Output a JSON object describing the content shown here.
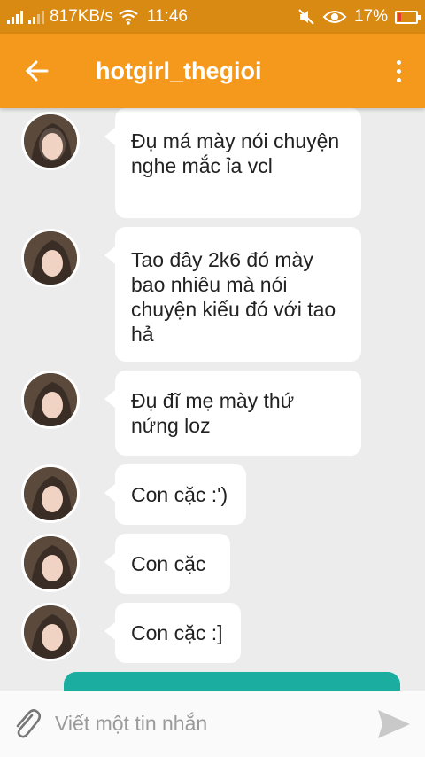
{
  "status_bar": {
    "speed": "817KB/s",
    "time": "11:46",
    "battery": "17%",
    "colors": {
      "background": "#d98a12",
      "battery_low": "#e53935"
    }
  },
  "header": {
    "title": "hotgirl_thegioi",
    "background": "#f4991b"
  },
  "messages": [
    {
      "sender": "incoming",
      "text": "Đụ má mày nói chuyện nghe mắc ỉa vcl"
    },
    {
      "sender": "incoming",
      "text": "Tao đây 2k6 đó mày bao nhiêu mà nói chuyện kiểu đó với tao hả"
    },
    {
      "sender": "incoming",
      "text": "Đụ đĩ mẹ mày thứ nứng loz"
    },
    {
      "sender": "incoming",
      "text": "Con cặc :')"
    },
    {
      "sender": "incoming",
      "text": "Con cặc"
    },
    {
      "sender": "incoming",
      "text": "Con cặc :]"
    }
  ],
  "composer": {
    "placeholder": "Viết một tin nhắn",
    "outgoing_bubble_color": "#1aada0"
  }
}
